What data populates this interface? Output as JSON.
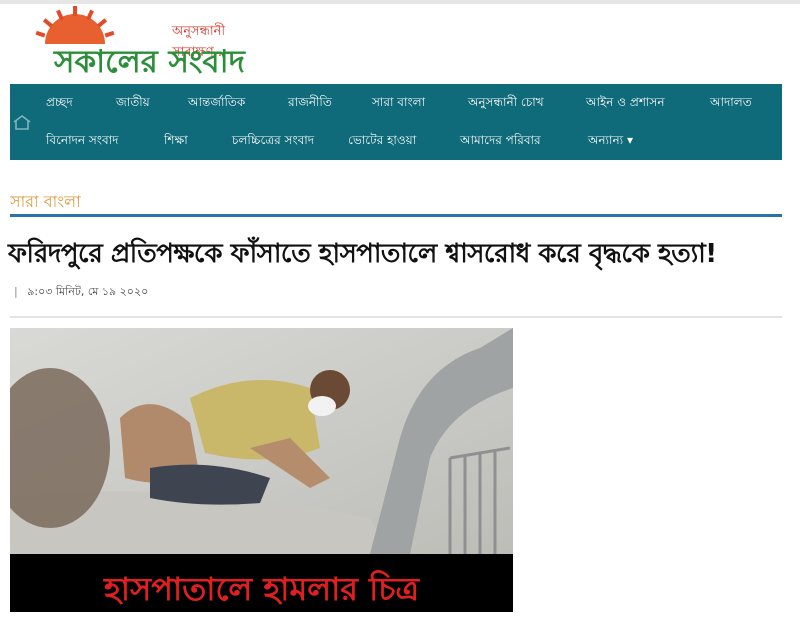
{
  "site": {
    "tagline": "অনুসন্ধানী সাবাক্ষণ...",
    "name": "সকালের সংবাদ"
  },
  "nav": {
    "row1": [
      "প্রচ্ছদ",
      "জাতীয়",
      "আন্তর্জাতিক",
      "রাজনীতি",
      "সারা বাংলা",
      "অনুসন্ধানী চোখ",
      "আইন ও প্রশাসন",
      "আদালত"
    ],
    "row2": [
      "বিনোদন সংবাদ",
      "শিক্ষা",
      "চলচ্চিত্রের সংবাদ",
      "ভোটের হাওয়া",
      "আমাদের পরিবার",
      "অন্যান্য ▾"
    ]
  },
  "article": {
    "section": "সারা বাংলা",
    "title": "ফরিদপুরে প্রতিপক্ষকে ফাঁসাতে হাসপাতালে শ্বাসরোধ করে বৃদ্ধকে হত্যা!",
    "separator": "|",
    "timestamp": "৯:০৩ মিনিট, মে ১৯ ২০২০",
    "image_caption": "হাসপাতালে হামলার চিত্র"
  },
  "colors": {
    "nav_bg": "#0f6a7a",
    "section_text": "#d99a3c",
    "section_rule": "#2a72a8",
    "logo_green": "#2b8f3a",
    "logo_red": "#d8322a",
    "caption_red": "#e02020"
  }
}
